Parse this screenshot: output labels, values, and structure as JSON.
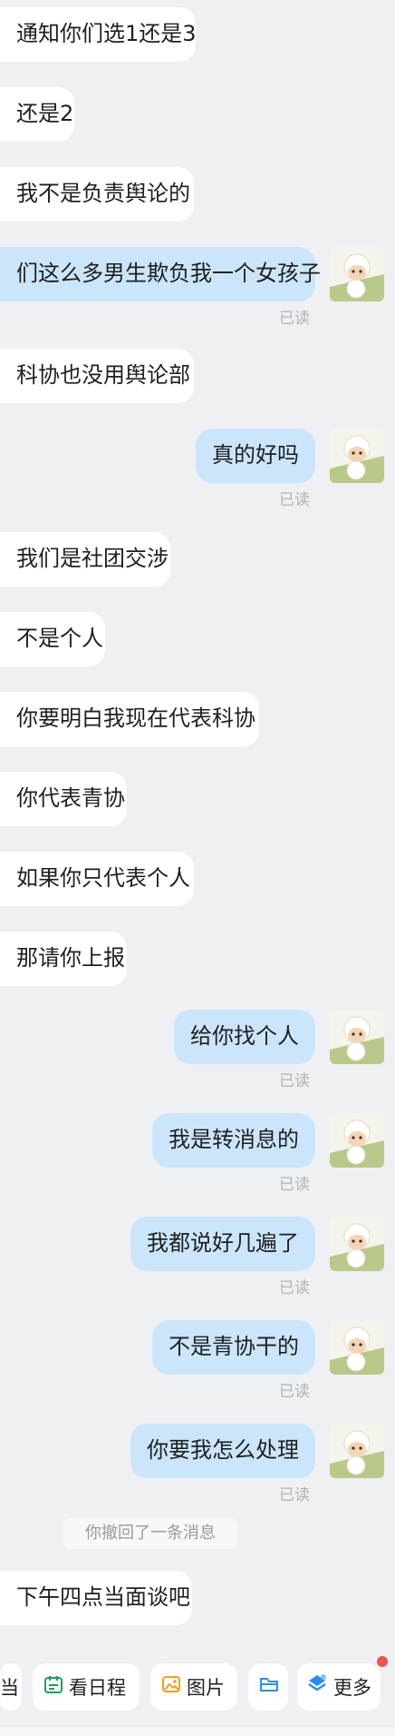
{
  "messages": [
    {
      "side": "in",
      "text": "通知你们选1还是3"
    },
    {
      "side": "in",
      "text": "还是2"
    },
    {
      "side": "in",
      "text": "我不是负责舆论的"
    },
    {
      "side": "out",
      "text": "们这么多男生欺负我一个女孩子",
      "read": "已读"
    },
    {
      "side": "in",
      "text": "科协也没用舆论部"
    },
    {
      "side": "out",
      "text": "真的好吗",
      "read": "已读"
    },
    {
      "side": "in",
      "text": "我们是社团交涉"
    },
    {
      "side": "in",
      "text": "不是个人"
    },
    {
      "side": "in",
      "text": "你要明白我现在代表科协"
    },
    {
      "side": "in",
      "text": "你代表青协"
    },
    {
      "side": "in",
      "text": "如果你只代表个人"
    },
    {
      "side": "in",
      "text": "那请你上报"
    },
    {
      "side": "out",
      "text": "给你找个人",
      "read": "已读"
    },
    {
      "side": "out",
      "text": "我是转消息的",
      "read": "已读"
    },
    {
      "side": "out",
      "text": "我都说好几遍了",
      "read": "已读"
    },
    {
      "side": "out",
      "text": "不是青协干的",
      "read": "已读"
    },
    {
      "side": "out",
      "text": "你要我怎么处理",
      "read": "已读"
    },
    {
      "side": "in",
      "text": "下午四点当面谈吧"
    }
  ],
  "recall_notice": "你撤回了一条消息",
  "toolbar": {
    "partial_label": "当",
    "schedule": {
      "label": "看日程",
      "icon": "calendar-icon",
      "color": "#1aa05a"
    },
    "image": {
      "label": "图片",
      "icon": "image-icon",
      "color": "#f0a020"
    },
    "file": {
      "label": "",
      "icon": "folder-icon",
      "color": "#2a8ef0"
    },
    "more": {
      "label": "更多",
      "icon": "more-app-icon",
      "color": "#2a8ef0"
    }
  }
}
